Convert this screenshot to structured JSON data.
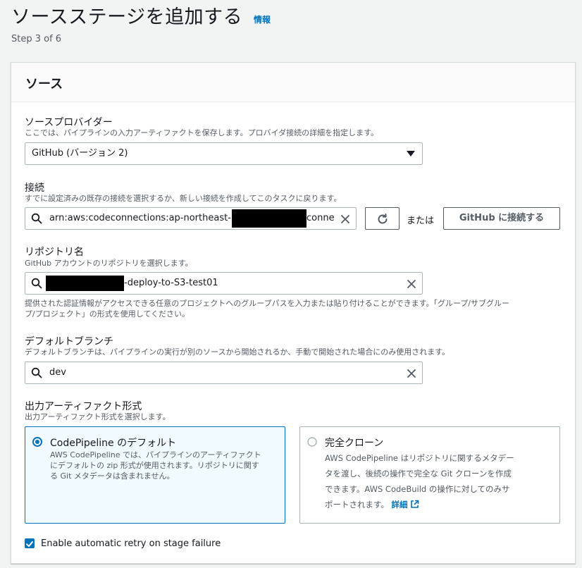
{
  "header": {
    "title": "ソースステージを追加する",
    "info_link": "情報",
    "step": "Step 3 of 6"
  },
  "panel": {
    "title": "ソース"
  },
  "source_provider": {
    "label": "ソースプロバイダー",
    "description": "ここでは、パイプラインの入力アーティファクトを保存します。プロバイダ接続の詳細を指定します。",
    "selected": "GitHub (バージョン 2)"
  },
  "connection": {
    "label": "接続",
    "description": "すでに設定済みの既存の接続を選択するか、新しい接続を作成してこのタスクに戻ります。",
    "value_prefix": "arn:aws:codeconnections:ap-northeast-1",
    "value_suffix": "conne",
    "or_text": "または",
    "connect_button": "GitHub に接続する"
  },
  "repository": {
    "label": "リポジトリ名",
    "description": "GitHub アカウントのリポジトリを選択します。",
    "value_suffix": "-deploy-to-S3-test01",
    "help_line1": "提供された認証情報がアクセスできる任意のプロジェクトへのグループパスを入力または貼り付けることができます。「グループ/サブグルー",
    "help_line2": "プ/プロジェクト」の形式を使用してください。"
  },
  "default_branch": {
    "label": "デフォルトブランチ",
    "description": "デフォルトブランチは、パイプラインの実行が別のソースから開始されるか、手動で開始された場合にのみ使用されます。",
    "value": "dev"
  },
  "artifact_format": {
    "label": "出力アーティファクト形式",
    "description": "出力アーティファクト形式を選択します。",
    "options": [
      {
        "title": "CodePipeline のデフォルト",
        "desc_lines": [
          "AWS CodePipeline では、パイプラインのアーティファクト",
          "にデフォルトの zip 形式が使用されます。リポジトリに関す",
          "る Git メタデータは含まれません。"
        ],
        "selected": true
      },
      {
        "title": "完全クローン",
        "desc_lines": [
          "AWS CodePipeline はリポジトリに関するメタデー",
          "タを渡し、後続の操作で完全な Git クローンを作成",
          "できます。AWS CodeBuild の操作に対してのみサ",
          "ポートされます。"
        ],
        "detail_link": "詳細",
        "selected": false
      }
    ]
  },
  "retry": {
    "label": "Enable automatic retry on stage failure",
    "checked": true
  },
  "colors": {
    "accent": "#0073bb",
    "text": "#16191f",
    "muted": "#545b64",
    "border": "#aab7b8"
  }
}
